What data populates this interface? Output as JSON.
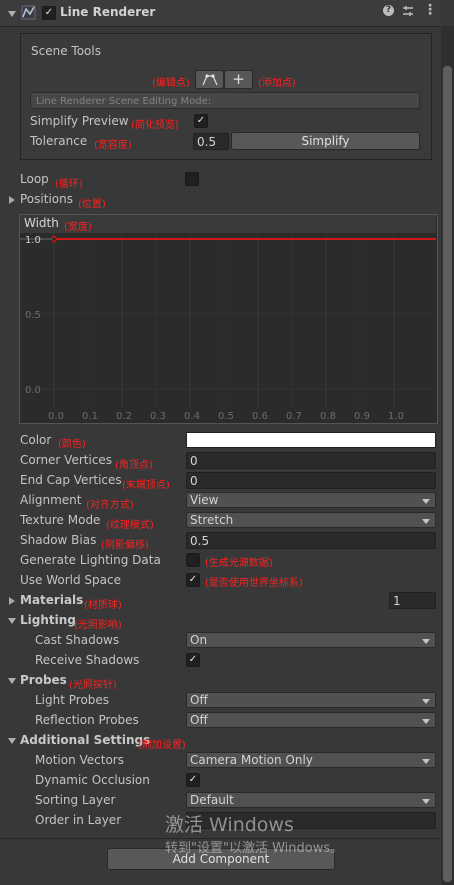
{
  "component": {
    "title": "Line Renderer",
    "enabled": true
  },
  "scene_tools": {
    "title": "Scene Tools",
    "edit_points_note": "(编辑点)",
    "add_points_note": "(添加点)",
    "editing_mode_placeholder": "Line Renderer Scene Editing Mode:",
    "simplify_preview_label": "Simplify Preview",
    "simplify_preview_note": "(简化预览)",
    "tolerance_label": "Tolerance",
    "tolerance_note": "(宽容度)",
    "tolerance_value": "0.5",
    "simplify_button": "Simplify"
  },
  "loop": {
    "label": "Loop",
    "note": "(循环)"
  },
  "positions": {
    "label": "Positions",
    "note": "(位置)"
  },
  "width": {
    "label": "Width",
    "note": "(宽度)",
    "y_ticks": [
      "1.0",
      "0.5",
      "0.0"
    ],
    "x_ticks": [
      "0.0",
      "0.1",
      "0.2",
      "0.3",
      "0.4",
      "0.5",
      "0.6",
      "0.7",
      "0.8",
      "0.9",
      "1.0"
    ]
  },
  "chart_data": {
    "type": "line",
    "title": "Width",
    "x": [
      0.0,
      1.0
    ],
    "series": [
      {
        "values": [
          1.0,
          1.0
        ]
      }
    ],
    "xlim": [
      0.0,
      1.0
    ],
    "ylim": [
      0.0,
      1.0
    ],
    "line_color": "#d01818"
  },
  "props": {
    "color": {
      "label": "Color",
      "note": "(颜色)",
      "value_color": "#ffffff"
    },
    "corner_vertices": {
      "label": "Corner Vertices",
      "note": "(角顶点)",
      "value": "0"
    },
    "end_cap_vertices": {
      "label": "End Cap Vertices",
      "note": "(末端顶点)",
      "value": "0"
    },
    "alignment": {
      "label": "Alignment",
      "note": "(对齐方式)",
      "value": "View"
    },
    "texture_mode": {
      "label": "Texture Mode",
      "note": "(纹理模式)",
      "value": "Stretch"
    },
    "shadow_bias": {
      "label": "Shadow Bias",
      "note": "(阴影偏移)",
      "value": "0.5"
    },
    "generate_lighting": {
      "label": "Generate Lighting Data",
      "note": "(生成光源数据)",
      "checked": false
    },
    "use_world_space": {
      "label": "Use World Space",
      "note": "(是否使用世界坐标系)",
      "checked": true
    }
  },
  "materials": {
    "label": "Materials",
    "note": "(材质球)",
    "count": "1"
  },
  "lighting": {
    "label": "Lighting",
    "note": "(光照影响)",
    "cast_shadows_label": "Cast Shadows",
    "cast_shadows_value": "On",
    "receive_shadows_label": "Receive Shadows",
    "receive_shadows_checked": true
  },
  "probes": {
    "label": "Probes",
    "note": "(光照探针)",
    "light_probes_label": "Light Probes",
    "light_probes_value": "Off",
    "reflection_probes_label": "Reflection Probes",
    "reflection_probes_value": "Off"
  },
  "additional": {
    "label": "Additional Settings",
    "note": "(附加设置)",
    "motion_vectors_label": "Motion Vectors",
    "motion_vectors_value": "Camera Motion Only",
    "dynamic_occlusion_label": "Dynamic Occlusion",
    "dynamic_occlusion_checked": true,
    "sorting_layer_label": "Sorting Layer",
    "sorting_layer_value": "Default",
    "order_in_layer_label": "Order in Layer"
  },
  "add_component_button": "Add Component",
  "watermark": {
    "line1": "激活 Windows",
    "line2": "转到\"设置\"以激活 Windows。"
  },
  "colors": {
    "annotation": "#ff2020",
    "curve": "#d01818",
    "background": "#383838"
  }
}
